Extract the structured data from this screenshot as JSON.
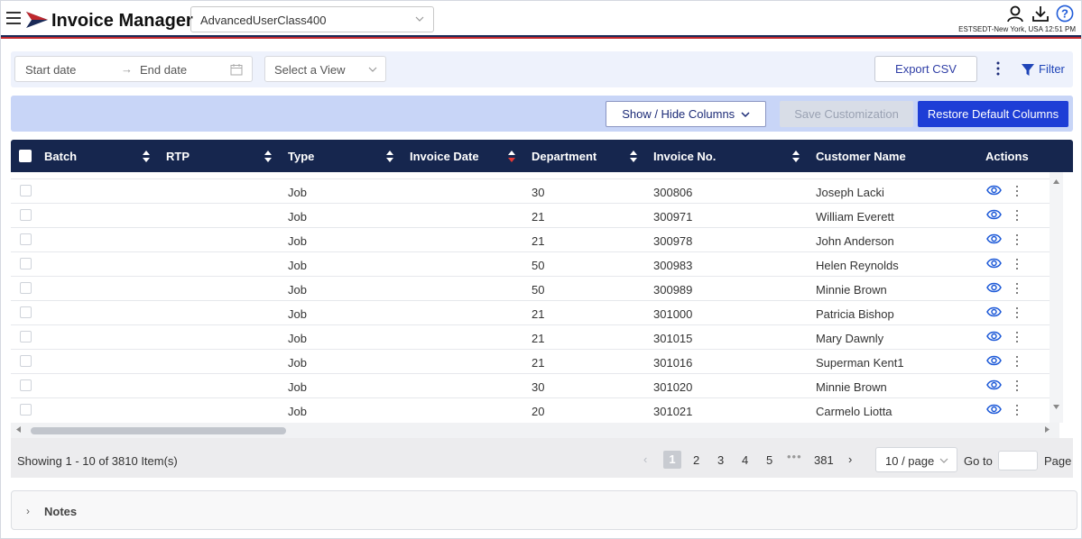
{
  "header": {
    "app_title": "Invoice Manager",
    "user_class": "AdvancedUserClass400",
    "timezone_clock": "ESTSEDT-New York, USA 12:51 PM",
    "icons": [
      "menu-icon",
      "logo-icon",
      "user-icon",
      "download-icon",
      "help-icon"
    ]
  },
  "filters": {
    "start_placeholder": "Start date",
    "end_placeholder": "End date",
    "view_placeholder": "Select a View",
    "export_label": "Export CSV",
    "filter_label": "Filter"
  },
  "customize": {
    "show_hide_label": "Show / Hide Columns",
    "save_label": "Save Customization",
    "restore_label": "Restore Default Columns"
  },
  "table": {
    "columns": [
      "Batch",
      "RTP",
      "Type",
      "Invoice Date",
      "Department",
      "Invoice No.",
      "Customer Name",
      "Actions"
    ],
    "rows": [
      {
        "type": "Job",
        "department": "30",
        "invoice_no": "300806",
        "customer": "Joseph Lacki"
      },
      {
        "type": "Job",
        "department": "21",
        "invoice_no": "300971",
        "customer": "William Everett"
      },
      {
        "type": "Job",
        "department": "21",
        "invoice_no": "300978",
        "customer": "John Anderson"
      },
      {
        "type": "Job",
        "department": "50",
        "invoice_no": "300983",
        "customer": "Helen Reynolds"
      },
      {
        "type": "Job",
        "department": "50",
        "invoice_no": "300989",
        "customer": "Minnie Brown"
      },
      {
        "type": "Job",
        "department": "21",
        "invoice_no": "301000",
        "customer": "Patricia Bishop"
      },
      {
        "type": "Job",
        "department": "21",
        "invoice_no": "301015",
        "customer": "Mary Dawnly"
      },
      {
        "type": "Job",
        "department": "21",
        "invoice_no": "301016",
        "customer": "Superman Kent1"
      },
      {
        "type": "Job",
        "department": "30",
        "invoice_no": "301020",
        "customer": "Minnie Brown"
      },
      {
        "type": "Job",
        "department": "20",
        "invoice_no": "301021",
        "customer": "Carmelo Liotta"
      }
    ]
  },
  "pagination": {
    "showing": "Showing 1 - 10 of 3810 Item(s)",
    "pages": [
      "1",
      "2",
      "3",
      "4",
      "5"
    ],
    "ellipsis": "•••",
    "last_page": "381",
    "per_page": "10 / page",
    "goto_label": "Go to",
    "page_label": "Page"
  },
  "notes": {
    "label": "Notes"
  },
  "colors": {
    "header_navy": "#16264e",
    "accent_blue": "#1e3ed6",
    "stripe_red": "#c0282d",
    "filter_bg": "#eef2fc",
    "customize_bg": "#c8d5f7"
  }
}
